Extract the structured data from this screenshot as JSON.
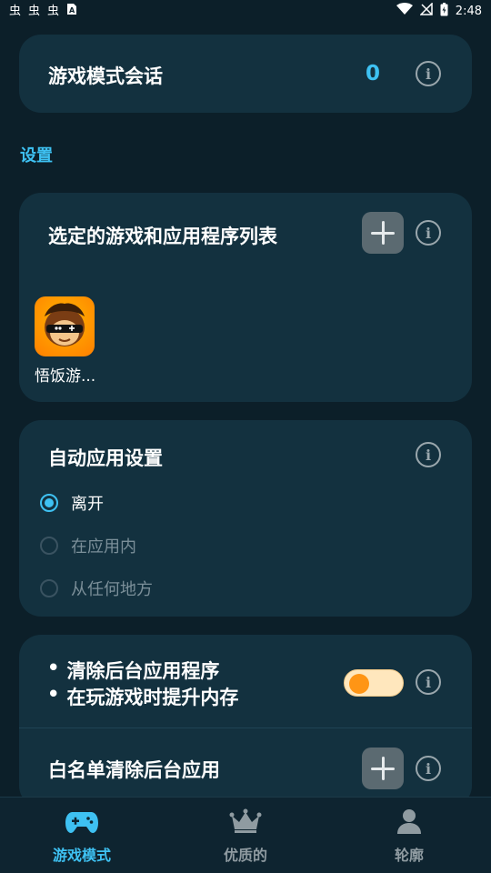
{
  "status_bar": {
    "time": "2:48",
    "left_icons": [
      "bug-icon",
      "bug-icon",
      "bug-icon",
      "sim-icon"
    ],
    "right_icons": [
      "wifi-icon",
      "no-signal-icon",
      "battery-icon"
    ]
  },
  "session_card": {
    "title": "游戏模式会话",
    "count": "0",
    "count_color": "#3ec1f2"
  },
  "settings_label": "设置",
  "apps_card": {
    "title": "选定的游戏和应用程序列表",
    "apps": [
      {
        "label": "悟饭游...",
        "icon": "game-app-icon"
      }
    ]
  },
  "auto_card": {
    "title": "自动应用设置",
    "options": [
      {
        "label": "离开",
        "selected": true
      },
      {
        "label": "在应用内",
        "selected": false
      },
      {
        "label": "从任何地方",
        "selected": false
      }
    ]
  },
  "boost_card": {
    "bullets": [
      "清除后台应用程序",
      "在玩游戏时提升内存"
    ],
    "bullet_mark": "•",
    "toggle_on": true,
    "whitelist_title": "白名单清除后台应用"
  },
  "bottom_nav": {
    "items": [
      {
        "label": "游戏模式",
        "icon": "gamepad-icon",
        "active": true
      },
      {
        "label": "优质的",
        "icon": "crown-icon",
        "active": false
      },
      {
        "label": "轮廓",
        "icon": "person-icon",
        "active": false
      }
    ]
  },
  "colors": {
    "accent": "#3ec1f2",
    "background": "#0c1f29",
    "card": "#13313f",
    "toggle_knob": "#ff9515"
  }
}
